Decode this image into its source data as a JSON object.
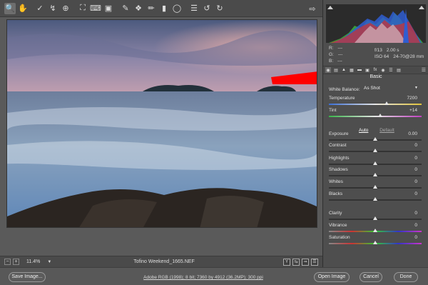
{
  "toolbar": {
    "tools": [
      "zoom-icon",
      "hand-icon",
      "white-balance-icon",
      "color-sampler-icon",
      "targeted-adjustment-icon",
      "crop-icon",
      "straighten-icon",
      "transform-icon",
      "spot-removal-icon",
      "red-eye-icon",
      "adjustment-brush-icon",
      "graduated-filter-icon",
      "radial-filter-icon",
      "preferences-icon",
      "rotate-left-icon",
      "rotate-right-icon"
    ],
    "fullscreen_icon": "fullscreen-icon"
  },
  "image": {
    "filename": "Tofino Weekend_1665.NEF",
    "zoom": "11.4%"
  },
  "histogram": {
    "rgb": {
      "r_label": "R:",
      "g_label": "G:",
      "b_label": "B:",
      "r": "---",
      "g": "---",
      "b": "---"
    },
    "exif": {
      "aperture": "f/13",
      "shutter": "2.00 s",
      "iso": "ISO 64",
      "lens": "24-70@28 mm"
    }
  },
  "panel": {
    "section": "Basic",
    "white_balance_label": "White Balance:",
    "white_balance_value": "As Shot",
    "auto": "Auto",
    "default": "Default",
    "controls": [
      {
        "label": "Temperature",
        "value": "7200",
        "pos": 0.62
      },
      {
        "label": "Tint",
        "value": "+14",
        "pos": 0.55
      },
      {
        "label": "Exposure",
        "value": "0.00",
        "pos": 0.5
      },
      {
        "label": "Contrast",
        "value": "0",
        "pos": 0.5
      },
      {
        "label": "Highlights",
        "value": "0",
        "pos": 0.5
      },
      {
        "label": "Shadows",
        "value": "0",
        "pos": 0.5
      },
      {
        "label": "Whites",
        "value": "0",
        "pos": 0.5
      },
      {
        "label": "Blacks",
        "value": "0",
        "pos": 0.5
      },
      {
        "label": "Clarity",
        "value": "0",
        "pos": 0.5
      },
      {
        "label": "Vibrance",
        "value": "0",
        "pos": 0.5
      },
      {
        "label": "Saturation",
        "value": "0",
        "pos": 0.5
      }
    ]
  },
  "footer": {
    "save": "Save Image...",
    "workflow": "Adobe RGB (1998); 8 bit; 7360 by 4912 (36.2MP); 300 ppi",
    "open": "Open Image",
    "cancel": "Cancel",
    "done": "Done"
  },
  "colors": {
    "clip_warning": "#ff0000",
    "panel_bg": "#4e4e4e"
  }
}
